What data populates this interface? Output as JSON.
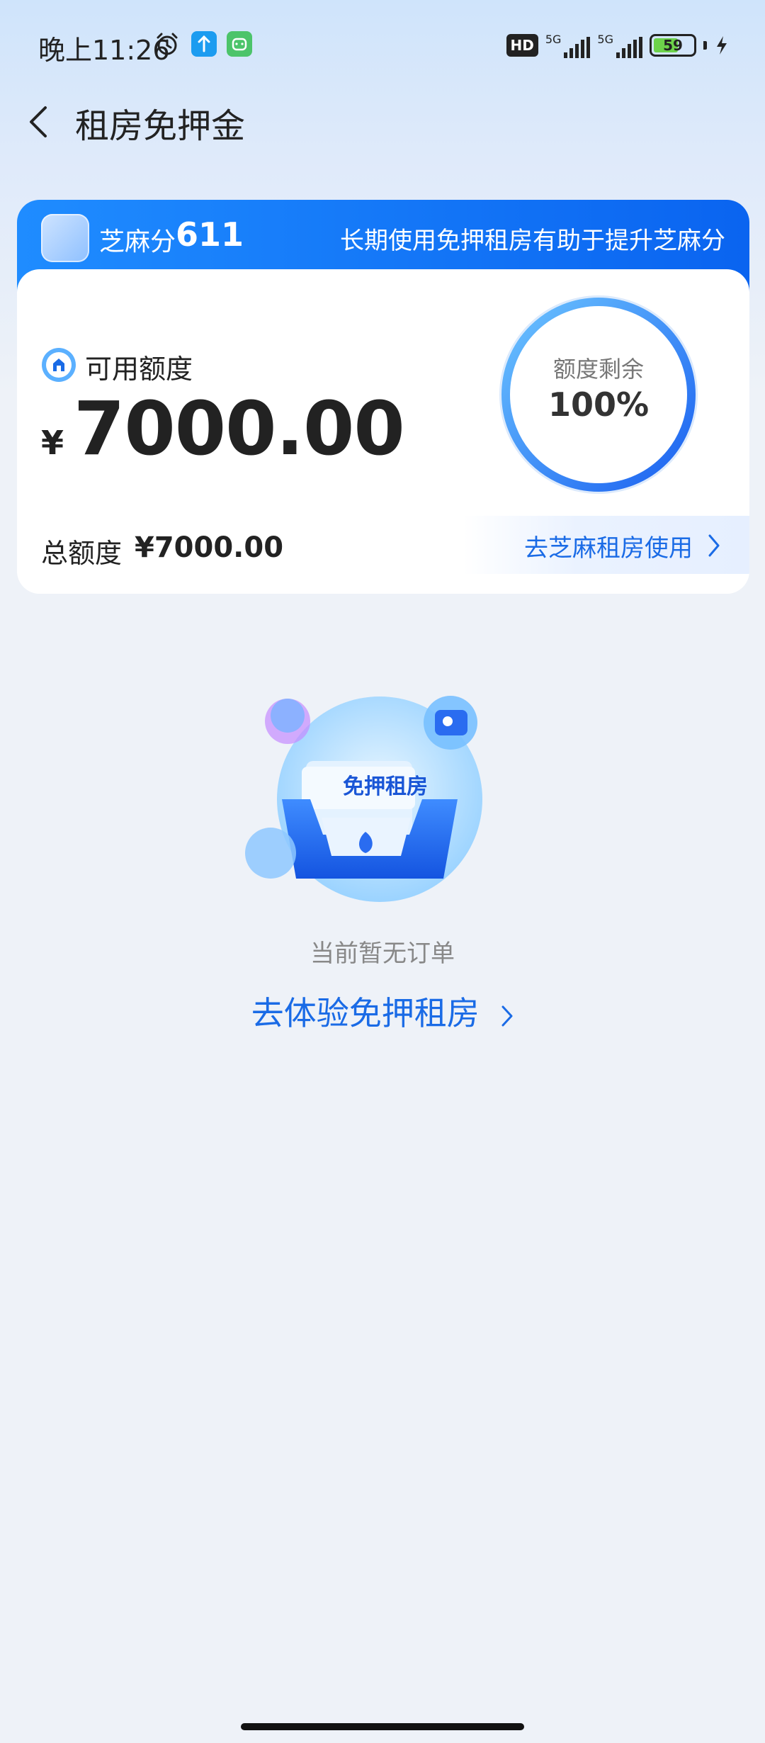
{
  "status_bar": {
    "time": "晚上11:26",
    "network_hd": "HD",
    "network1": "5G",
    "network2": "5G",
    "battery": "59"
  },
  "header": {
    "title": "租房免押金"
  },
  "credit_card": {
    "zhima_label": "芝麻分",
    "zhima_score": "611",
    "banner_tip": "长期使用免押租房有助于提升芝麻分",
    "available_label": "可用额度",
    "currency": "¥",
    "available_amount": "7000.00",
    "remaining_label": "额度剩余",
    "remaining_percent": "100%",
    "remaining_fraction": 1.0,
    "total_label": "总额度",
    "total_amount": "¥7000.00",
    "use_link": "去芝麻租房使用"
  },
  "empty_state": {
    "illustration_text": "免押租房",
    "message": "当前暂无订单",
    "action": "去体验免押租房"
  },
  "colors": {
    "accent": "#1a6be6",
    "banner_start": "#1f8cff",
    "banner_end": "#0a64f0",
    "page_bg": "#eef2f8"
  }
}
